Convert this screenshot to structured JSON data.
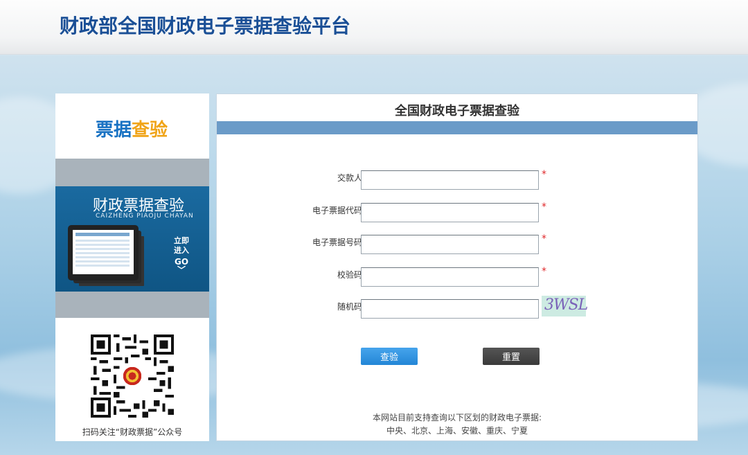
{
  "header": {
    "title": "财政部全国财政电子票据查验平台"
  },
  "sidebar": {
    "logo_part1": "票据",
    "logo_part2": "查验",
    "promo_title": "财政票据查验",
    "promo_subtitle": "CAIZHENG PIAOJU CHAYAN",
    "enter_line1": "立即",
    "enter_line2": "进入",
    "enter_go": "GO",
    "enter_chevron": "﹀",
    "qr_caption": "扫码关注“财政票据”公众号"
  },
  "panel": {
    "title": "全国财政电子票据查验",
    "fields": [
      {
        "label": "交款人:",
        "value": "",
        "required": true
      },
      {
        "label": "电子票据代码:",
        "value": "",
        "required": true
      },
      {
        "label": "电子票据号码:",
        "value": "",
        "required": true
      },
      {
        "label": "校验码:",
        "value": "",
        "required": true
      },
      {
        "label": "随机码:",
        "value": "",
        "required": false
      }
    ],
    "required_mark": "*",
    "captcha_text": "3WSL",
    "check_button": "查验",
    "reset_button": "重置",
    "notice_line1": "本网站目前支持查询以下区划的财政电子票据:",
    "notice_line2": "中央、北京、上海、安徽、重庆、宁夏"
  },
  "colors": {
    "brand_blue": "#1a4f96",
    "logo_blue": "#1872c3",
    "logo_orange": "#f0a418",
    "panel_bar": "#6b9bc8",
    "required_red": "#e0292b",
    "check_button": "#2386d6",
    "reset_button": "#3a3a3a"
  }
}
